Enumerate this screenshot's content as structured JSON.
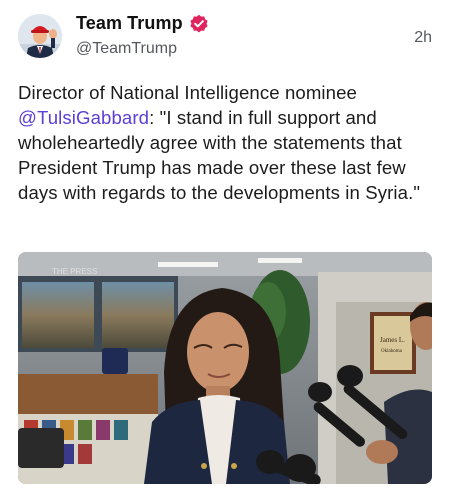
{
  "post": {
    "author": {
      "display_name": "Team Trump",
      "handle": "@TeamTrump",
      "verified": true,
      "verified_color": "#e0245e",
      "avatar_icon": "profile-photo"
    },
    "timestamp": "2h",
    "text": {
      "before_mention": "Director of National Intelligence nominee ",
      "mention": "@TulsiGabbard",
      "after_mention": ": \"I stand in full support and wholeheartedly agree with the statements that President Trump has made over these last few days with regards to the developments in Syria.\""
    },
    "media": {
      "type": "photo",
      "icon": "press-photo",
      "background_sign_text": "THE PRESS",
      "plaque_text": "James L.",
      "plaque_subtext": "Oklahoma"
    }
  },
  "colors": {
    "mention": "#5b3fd6",
    "text": "#1c1c1c",
    "secondary": "#55595f"
  }
}
